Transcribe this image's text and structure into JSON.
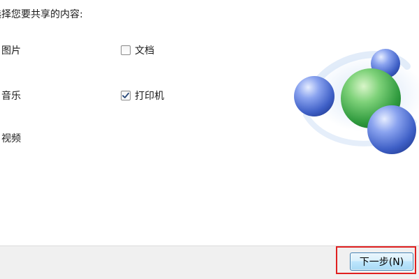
{
  "prompt": "选择您要共享的内容:",
  "libraries": {
    "pictures": "图片",
    "music": "音乐",
    "videos": "视频"
  },
  "options": {
    "documents": {
      "label": "文档",
      "checked": false
    },
    "printers": {
      "label": "打印机",
      "checked": true
    }
  },
  "footer": {
    "next_label": "下一步(N)"
  },
  "colors": {
    "highlight": "#e02020",
    "sphere_green": "#3fae4a",
    "sphere_blue": "#3f63c8"
  }
}
